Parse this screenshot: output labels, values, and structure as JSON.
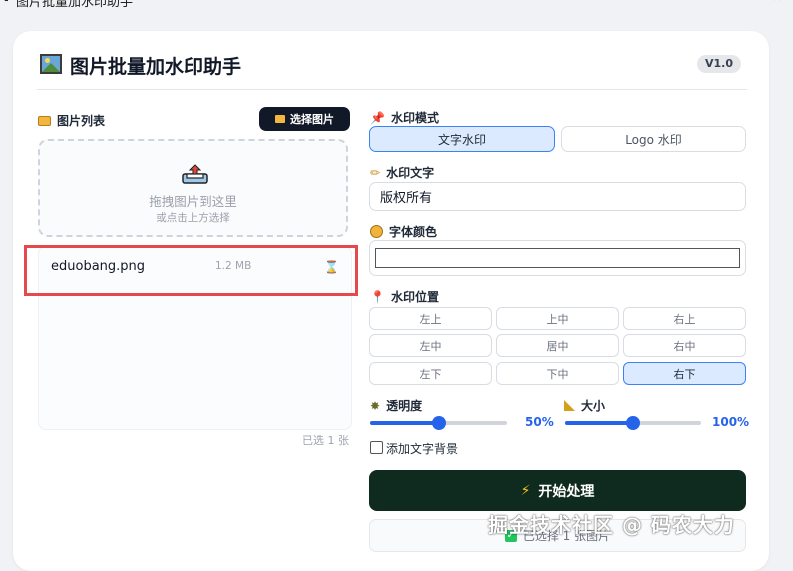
{
  "window": {
    "title": "图片批量加水印助手",
    "minimize": "—",
    "close": "✕"
  },
  "header": {
    "title": "图片批量加水印助手",
    "version": "V1.0"
  },
  "left": {
    "section_label": "图片列表",
    "select_button": "选择图片",
    "dropzone": {
      "main": "拖拽图片到这里",
      "sub": "或点击上方选择"
    },
    "files": [
      {
        "name": "eduobang.png",
        "size": "1.2 MB",
        "status_icon": "⌛"
      }
    ],
    "selected_count": "已选 1 张"
  },
  "right": {
    "mode": {
      "label": "水印模式",
      "options": [
        "文字水印",
        "Logo 水印"
      ],
      "selected": "文字水印"
    },
    "text": {
      "label": "水印文字",
      "value": "版权所有"
    },
    "color": {
      "label": "字体颜色",
      "value": "#ffffff"
    },
    "position": {
      "label": "水印位置",
      "options": [
        "左上",
        "上中",
        "右上",
        "左中",
        "居中",
        "右中",
        "左下",
        "下中",
        "右下"
      ],
      "selected": "右下"
    },
    "opacity": {
      "label": "透明度",
      "value_text": "50%",
      "fraction": 0.5
    },
    "size": {
      "label": "大小",
      "value_text": "100%",
      "fraction": 0.5
    },
    "bg_checkbox": {
      "label": "添加文字背景",
      "checked": false
    },
    "start_button": "开始处理",
    "status": "已选择 1 张图片"
  },
  "overlay_watermark": "掘金技术社区 @ 码农大力"
}
